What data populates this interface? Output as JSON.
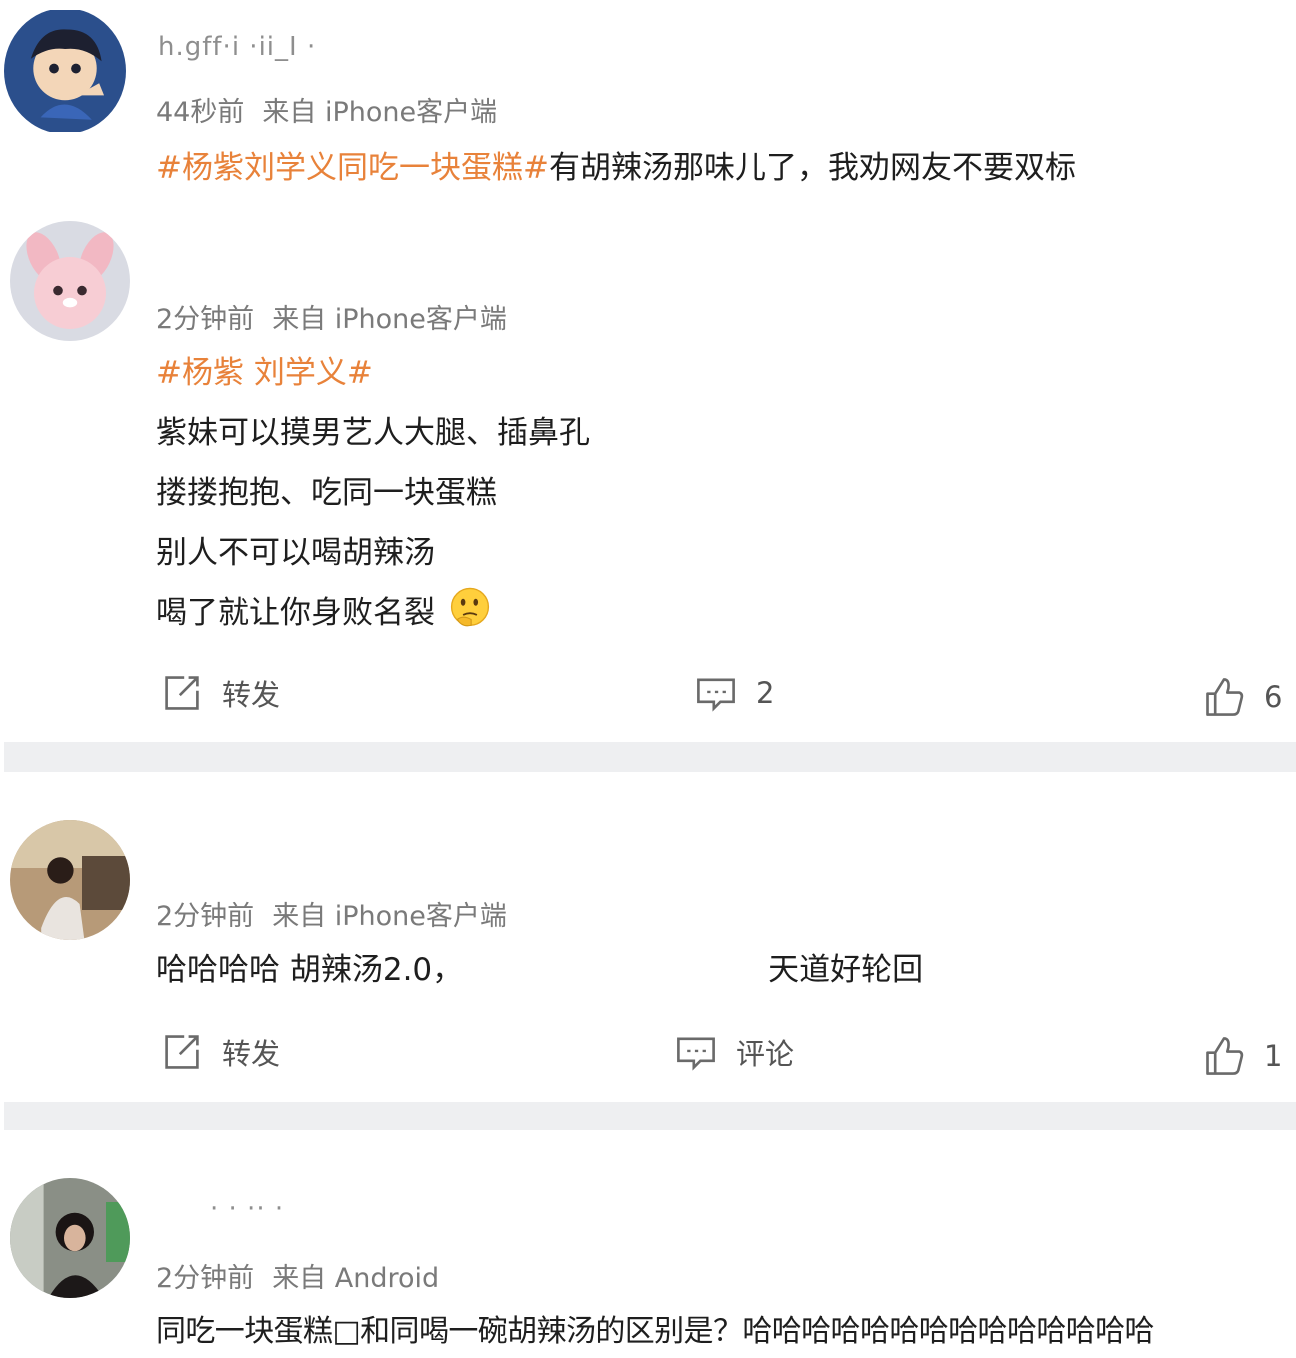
{
  "posts": [
    {
      "username": "h.gff·i  ·ii_I ·",
      "time": "44秒前",
      "source": "来自 iPhone客户端",
      "hashtag": "#杨紫刘学义同吃一块蛋糕#",
      "text": "有胡辣汤那味儿了，我劝网友不要双标"
    },
    {
      "time": "2分钟前",
      "source": "来自 iPhone客户端",
      "hashtag": "#杨紫 刘学义#",
      "lines": [
        "紫妹可以摸男艺人大腿、插鼻孔",
        "搂搂抱抱、吃同一块蛋糕",
        "别人不可以喝胡辣汤",
        "喝了就让你身败名裂"
      ],
      "emoji": "thinking-face-icon",
      "actions": {
        "repost": "转发",
        "comment": "2",
        "like": "6"
      }
    },
    {
      "time": "2分钟前",
      "source": "来自 iPhone客户端",
      "text_a": "哈哈哈哈 胡辣汤2.0，",
      "text_b": "天道好轮回",
      "actions": {
        "repost": "转发",
        "comment": "评论",
        "like": "1"
      }
    },
    {
      "username": "· ·  ··  ·",
      "time": "2分钟前",
      "source": "来自 Android",
      "text": "同吃一块蛋糕□和同喝一碗胡辣汤的区别是？哈哈哈哈哈哈哈哈哈哈哈哈哈哈"
    }
  ],
  "colors": {
    "hashtag": "#e8823a",
    "meta": "#7a7a7a",
    "separator": "#eeeff1"
  }
}
